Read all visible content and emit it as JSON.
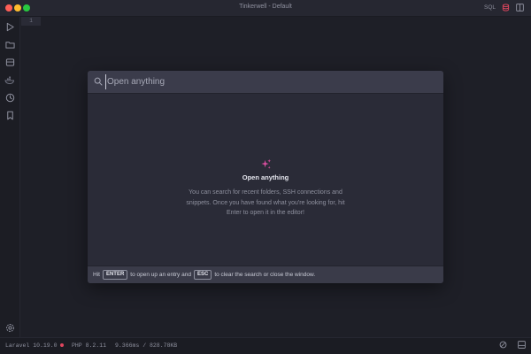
{
  "window": {
    "title": "Tinkerwell - Default",
    "sql_label": "SQL"
  },
  "sidebar": {
    "items": [
      {
        "icon": "play-icon"
      },
      {
        "icon": "folder-icon"
      },
      {
        "icon": "database-icon"
      },
      {
        "icon": "docker-icon"
      },
      {
        "icon": "history-icon"
      },
      {
        "icon": "bookmark-icon"
      }
    ],
    "bottom_icon": "gear-icon"
  },
  "editor": {
    "line_number": "1"
  },
  "modal": {
    "search_placeholder": "Open anything",
    "empty_title": "Open anything",
    "empty_description": "You can search for recent folders, SSH connections and snippets. Once you have found what you're looking for, hit Enter to open it in the editor!",
    "footer": {
      "hit": "Hit",
      "enter_key": "ENTER",
      "enter_text": "to open up an entry and",
      "esc_key": "ESC",
      "esc_text": "to clear the search or close the window."
    }
  },
  "status": {
    "laravel": "Laravel 10.19.0",
    "php": "PHP 8.2.11",
    "metrics": "9.366ms / 828.78KB"
  },
  "colors": {
    "accent": "#e0465e",
    "sparkle": "#d94fa0"
  }
}
